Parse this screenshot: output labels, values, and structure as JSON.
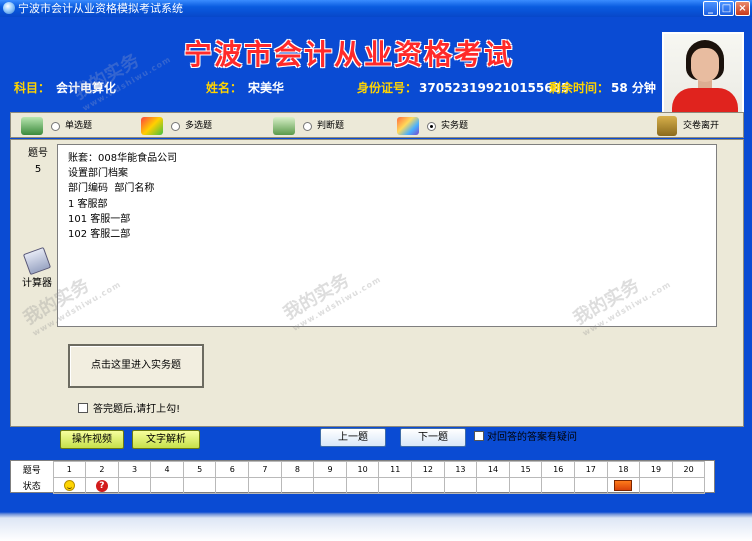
{
  "window": {
    "title": "宁波市会计从业资格模拟考试系统"
  },
  "header": {
    "title": "宁波市会计从业资格考试",
    "subject_label": "科目：",
    "subject_value": "会计电算化",
    "name_label": "姓名：",
    "name_value": "宋美华",
    "id_label": "身份证号：",
    "id_value": "370523199210155685",
    "time_label": "剩余时间：",
    "time_value": "58 分钟"
  },
  "toolbar": {
    "options": [
      {
        "label": "单选题",
        "selected": false
      },
      {
        "label": "多选题",
        "selected": false
      },
      {
        "label": "判断题",
        "selected": false
      },
      {
        "label": "实务题",
        "selected": true
      }
    ],
    "submit_label": "交卷离开"
  },
  "question": {
    "number_label": "题号",
    "number_value": "5",
    "lines": [
      "账套：008华能食品公司",
      "设置部门档案",
      "部门编码  部门名称",
      "1 客服部",
      "101 客服一部",
      "102 客服二部"
    ]
  },
  "calculator": {
    "label": "计算器",
    "icon": "calculator-icon"
  },
  "practice_button": "点击这里进入实务题",
  "done_checkbox": "答完题后,请打上勾!",
  "buttons": {
    "video": "操作视频",
    "analysis": "文字解析",
    "prev": "上一题",
    "next": "下一题"
  },
  "doubt_checkbox": "对回答的答案有疑问",
  "status_grid": {
    "row1_label": "题号",
    "row2_label": "状态",
    "numbers": [
      "1",
      "2",
      "3",
      "4",
      "5",
      "6",
      "7",
      "8",
      "9",
      "10",
      "11",
      "12",
      "13",
      "14",
      "15",
      "16",
      "17",
      "18",
      "19",
      "20"
    ],
    "states": [
      "smiley",
      "question",
      "",
      "",
      "",
      "",
      "",
      "",
      "",
      "",
      "",
      "",
      "",
      "",
      "",
      "",
      "",
      "arrows",
      "",
      ""
    ]
  },
  "watermark": {
    "text": "我的实务",
    "url": "www.wdshiwu.com"
  },
  "colors": {
    "background": "#0a4bd3",
    "title": "#ff2a2a",
    "info": "#ffd400"
  }
}
